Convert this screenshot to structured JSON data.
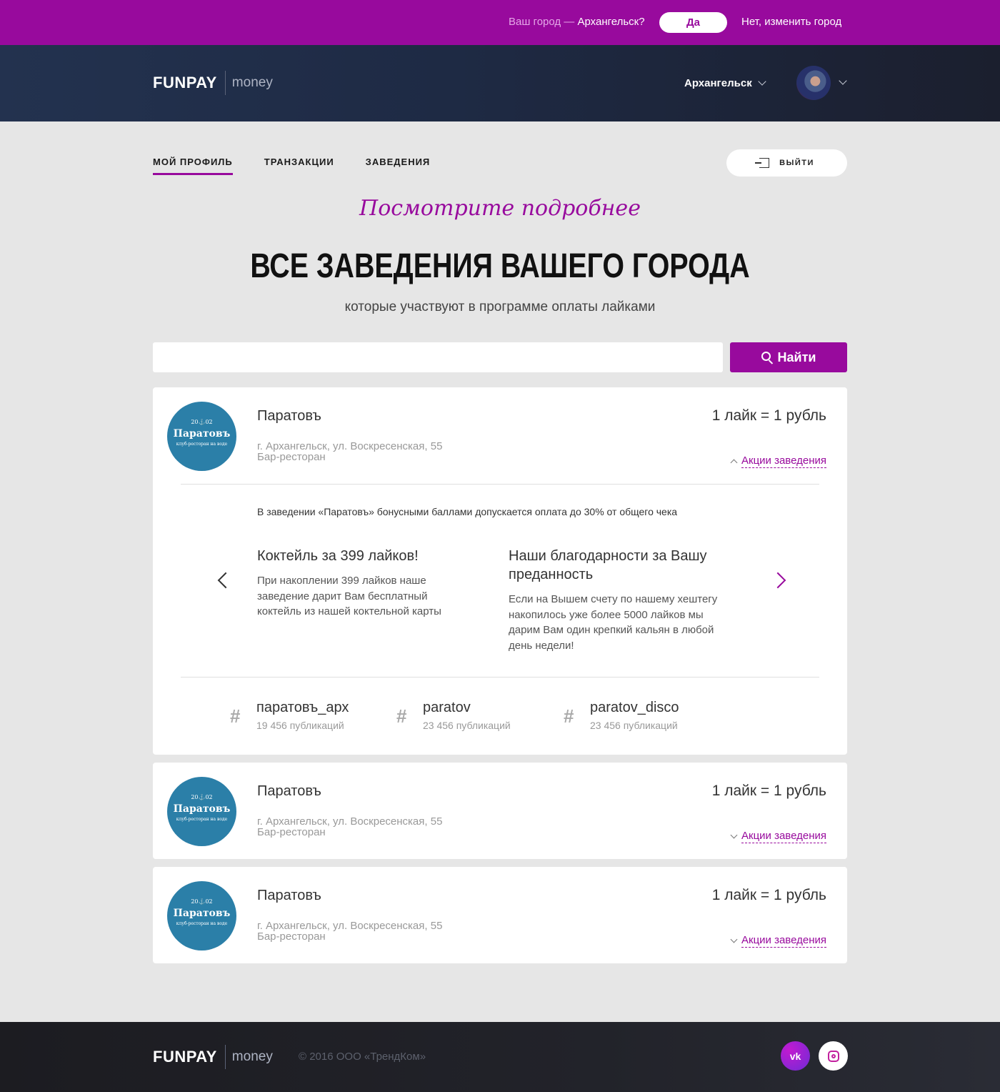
{
  "city_bar": {
    "question_prefix": "Ваш город —",
    "question_city": "Архангельск?",
    "yes_label": "Да",
    "no_label": "Нет, изменить город"
  },
  "header": {
    "logo_main": "FUNPAY",
    "logo_sub": "money",
    "city": "Архангельск"
  },
  "nav": {
    "tabs": [
      {
        "label": "МОЙ ПРОФИЛЬ",
        "active": true
      },
      {
        "label": "ТРАНЗАКЦИИ",
        "active": false
      },
      {
        "label": "ЗАВЕДЕНИЯ",
        "active": false
      }
    ],
    "logout_label": "ВЫЙТИ"
  },
  "hero": {
    "script": "Посмотрите подробнее",
    "title": "ВСЕ ЗАВЕДЕНИЯ ВАШЕГО ГОРОДА",
    "subtitle": "которые участвуют в программе оплаты лайками"
  },
  "search": {
    "placeholder": "",
    "button_label": "Найти"
  },
  "venues": [
    {
      "logo_year": "20⚓02",
      "logo_name": "Паратовъ",
      "logo_sub": "клуб-ресторан на воде",
      "name": "Паратовъ",
      "address": "г. Архангельск, ул. Воскресенская, 55",
      "type": "Бар-ресторан",
      "rate": "1 лайк = 1 рубль",
      "promos_label": "Акции заведения",
      "expanded": true,
      "note": "В заведении «Паратовъ» бонусными баллами допускается оплата до 30% от общего чека",
      "slides": [
        {
          "title": "Коктейль за 399 лайков!",
          "text": "При накоплении 399 лайков наше заведение дарит Вам бесплатный коктейль из нашей коктельной карты"
        },
        {
          "title": "Наши благодарности за Вашу преданность",
          "text": "Если на Вышем счету по нашему хештегу накопилось уже более 5000 лайков мы дарим Вам один крепкий кальян в любой день недели!"
        }
      ],
      "hashtags": [
        {
          "hash": "#",
          "name": "паратовъ_арх",
          "count": "19 456 публикаций"
        },
        {
          "hash": "#",
          "name": "paratov",
          "count": "23 456 публикаций"
        },
        {
          "hash": "#",
          "name": "paratov_disco",
          "count": "23 456 публикаций"
        }
      ]
    },
    {
      "logo_year": "20⚓02",
      "logo_name": "Паратовъ",
      "logo_sub": "клуб-ресторан на воде",
      "name": "Паратовъ",
      "address": "г. Архангельск, ул. Воскресенская, 55",
      "type": "Бар-ресторан",
      "rate": "1 лайк = 1 рубль",
      "promos_label": "Акции заведения",
      "expanded": false
    },
    {
      "logo_year": "20⚓02",
      "logo_name": "Паратовъ",
      "logo_sub": "клуб-ресторан на воде",
      "name": "Паратовъ",
      "address": "г. Архангельск, ул. Воскресенская, 55",
      "type": "Бар-ресторан",
      "rate": "1 лайк = 1 рубль",
      "promos_label": "Акции заведения",
      "expanded": false
    }
  ],
  "footer": {
    "logo_main": "FUNPAY",
    "logo_sub": "money",
    "copyright": "© 2016 ООО «ТрендКом»",
    "social": [
      {
        "name": "vk-icon",
        "glyph": "vk"
      },
      {
        "name": "instagram-icon",
        "glyph": ""
      }
    ]
  },
  "colors": {
    "accent": "#980a9d",
    "venue_logo": "#2b7fa8",
    "header_dark": "#1e2a44"
  }
}
